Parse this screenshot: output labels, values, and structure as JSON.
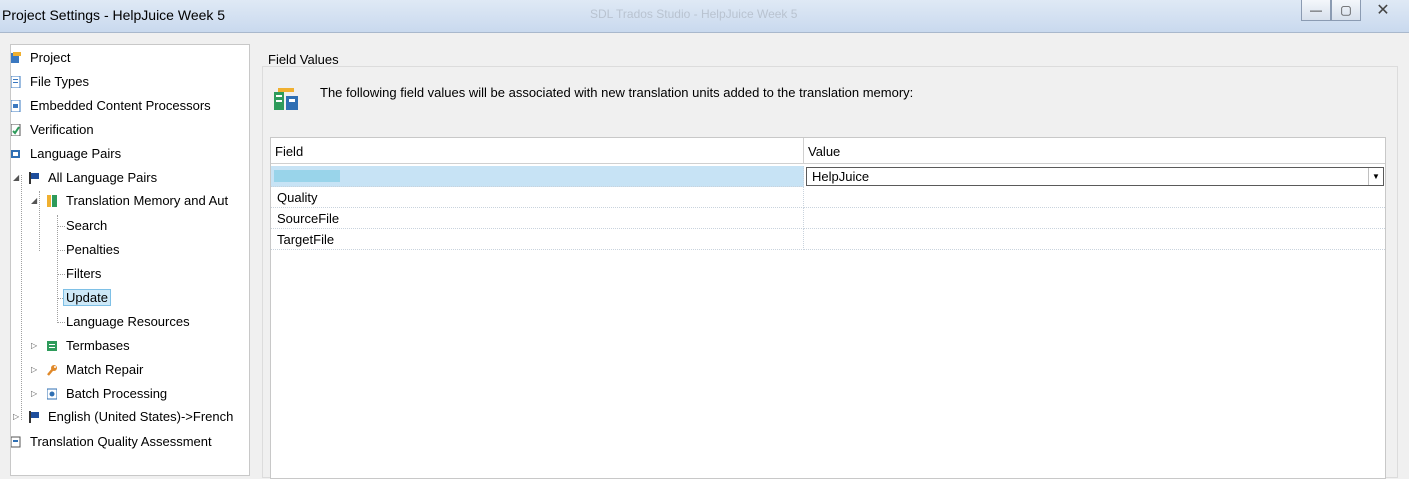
{
  "window": {
    "title": "Project Settings - HelpJuice Week 5",
    "ghost_title": "SDL Trados Studio - HelpJuice Week 5",
    "min_glyph": "—",
    "max_glyph": "▢",
    "close_glyph": "✕"
  },
  "tree": {
    "items": [
      {
        "label": "Project",
        "icon": "project-icon"
      },
      {
        "label": "File Types",
        "icon": "file-types-icon"
      },
      {
        "label": "Embedded Content Processors",
        "icon": "embedded-content-icon"
      },
      {
        "label": "Verification",
        "icon": "verification-icon"
      },
      {
        "label": "Language Pairs",
        "icon": "language-pairs-icon"
      },
      {
        "label": "All Language Pairs",
        "icon": "flag-icon"
      },
      {
        "label": "Translation Memory and Aut",
        "icon": "tm-icon"
      },
      {
        "label": "Search"
      },
      {
        "label": "Penalties"
      },
      {
        "label": "Filters"
      },
      {
        "label": "Update"
      },
      {
        "label": "Language Resources"
      },
      {
        "label": "Termbases",
        "icon": "termbase-icon"
      },
      {
        "label": "Match Repair",
        "icon": "wrench-icon"
      },
      {
        "label": "Batch Processing",
        "icon": "batch-icon"
      },
      {
        "label": "English (United States)->French",
        "icon": "flag-icon"
      },
      {
        "label": "Translation Quality Assessment",
        "icon": "tqa-icon"
      }
    ],
    "selected": "Update"
  },
  "panel": {
    "section_title": "Field Values",
    "description": "The following field values will be associated with new translation units added to the translation memory:",
    "grid": {
      "columns": [
        "Field",
        "Value"
      ],
      "rows": [
        {
          "field": "",
          "value": "HelpJuice"
        },
        {
          "field": "Quality",
          "value": ""
        },
        {
          "field": "SourceFile",
          "value": ""
        },
        {
          "field": "TargetFile",
          "value": ""
        }
      ]
    }
  },
  "colors": {
    "selection": "#cde8f7",
    "row_highlight": "#c7e3f5",
    "icon_green": "#2e9b5b",
    "icon_blue": "#2f6fb3",
    "flag_blue": "#1f4e9c",
    "wrench_orange": "#e0892a"
  }
}
